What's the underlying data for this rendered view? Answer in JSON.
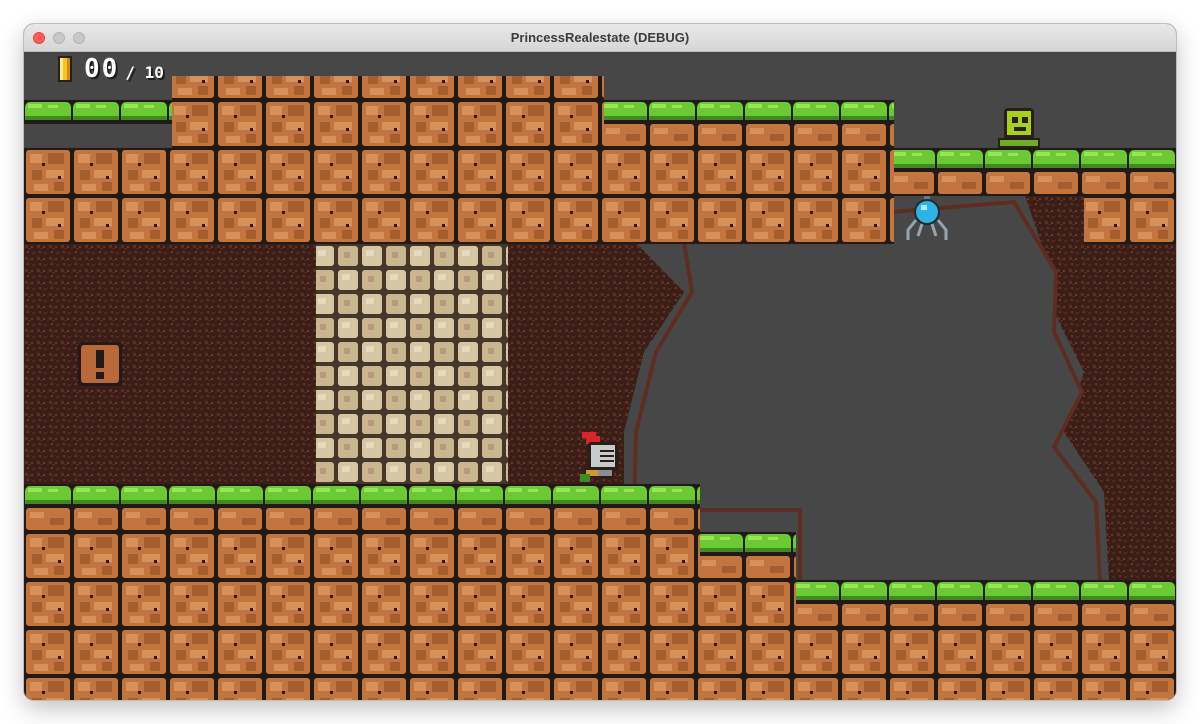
{
  "window": {
    "title": "PrincessRealestate (DEBUG)"
  },
  "hud": {
    "coins_collected": "00",
    "coins_total": "/ 10"
  },
  "icons": {
    "coin": "coin-icon",
    "player": "knight-icon",
    "enemy": "skull-slime-icon",
    "spider": "blue-orb-spider-icon",
    "hint": "exclamation-block-icon"
  },
  "colors": {
    "background": "#474747",
    "grass": "#6ccb35",
    "dirt": "#c2753f",
    "dirt_dark": "#8a4b25",
    "cave_wall": "#3c1f18",
    "stone": "#d6c6a4"
  }
}
